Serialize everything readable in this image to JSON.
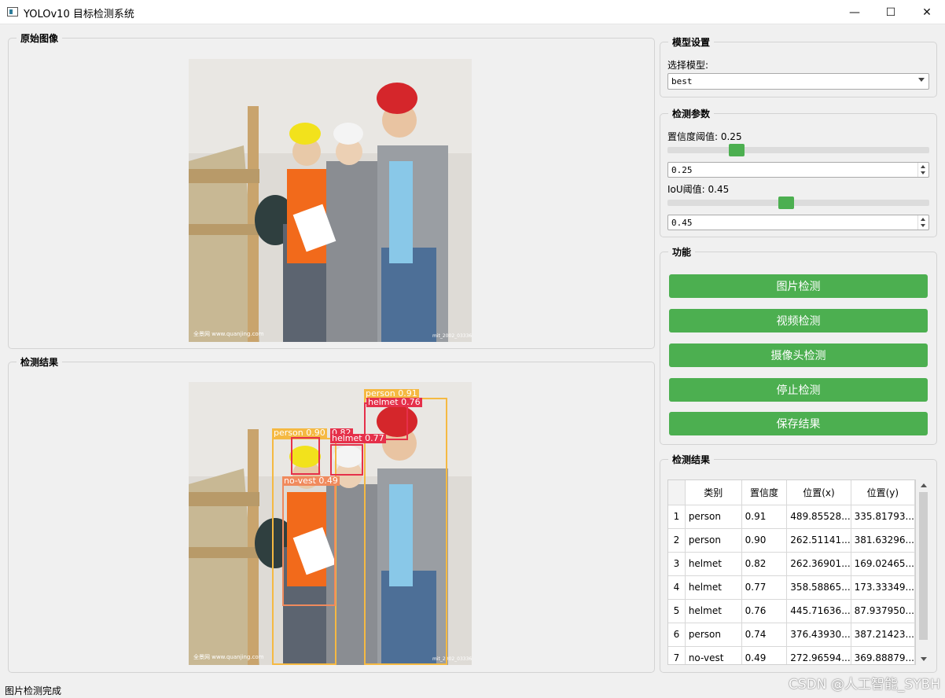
{
  "window": {
    "title": "YOLOv10 目标检测系统",
    "controls": {
      "minimize": "—",
      "maximize": "☐",
      "close": "✕"
    }
  },
  "original_panel": {
    "title": "原始图像",
    "watermark_left": "全景网 www.quanjing.com",
    "watermark_right": "mit_2002_03336"
  },
  "result_panel": {
    "title": "检测结果",
    "watermark_left": "全景网 www.quanjing.com",
    "watermark_right": "mit_2002_03336"
  },
  "detections_overlay": [
    {
      "label": "person 0.91",
      "color": "#f5b942"
    },
    {
      "label": "helmet 0.76",
      "color": "#e5304a"
    },
    {
      "label": "person 0.90",
      "color": "#f5b942"
    },
    {
      "label": "0.82",
      "color": "#e5304a"
    },
    {
      "label": "helmet 0.77",
      "color": "#e5304a"
    },
    {
      "label": "no-vest 0.49",
      "color": "#f08a5d"
    }
  ],
  "model_settings": {
    "title": "模型设置",
    "select_label": "选择模型:",
    "selected": "best"
  },
  "detect_params": {
    "title": "检测参数",
    "conf_label": "置信度阈值: 0.25",
    "conf_value": "0.25",
    "conf_level": 0.25,
    "iou_label": "IoU阈值: 0.45",
    "iou_value": "0.45",
    "iou_level": 0.45
  },
  "functions": {
    "title": "功能",
    "buttons": [
      "图片检测",
      "视频检测",
      "摄像头检测",
      "停止检测",
      "保存结果"
    ]
  },
  "results_table": {
    "title": "检测结果",
    "headers": [
      "类别",
      "置信度",
      "位置(x)",
      "位置(y)"
    ],
    "rows": [
      [
        "1",
        "person",
        "0.91",
        "489.85528...",
        "335.81793..."
      ],
      [
        "2",
        "person",
        "0.90",
        "262.51141...",
        "381.63296..."
      ],
      [
        "3",
        "helmet",
        "0.82",
        "262.36901...",
        "169.02465..."
      ],
      [
        "4",
        "helmet",
        "0.77",
        "358.58865...",
        "173.33349..."
      ],
      [
        "5",
        "helmet",
        "0.76",
        "445.71636...",
        "87.937950..."
      ],
      [
        "6",
        "person",
        "0.74",
        "376.43930...",
        "387.21423..."
      ],
      [
        "7",
        "no-vest",
        "0.49",
        "272.96594...",
        "369.88879..."
      ]
    ]
  },
  "status": "图片检测完成",
  "page_watermark": "CSDN @人工智能_SYBH",
  "colors": {
    "accent": "#4caf50",
    "person_box": "#f5b942",
    "helmet_box": "#e5304a",
    "novest_box": "#f08a5d"
  }
}
